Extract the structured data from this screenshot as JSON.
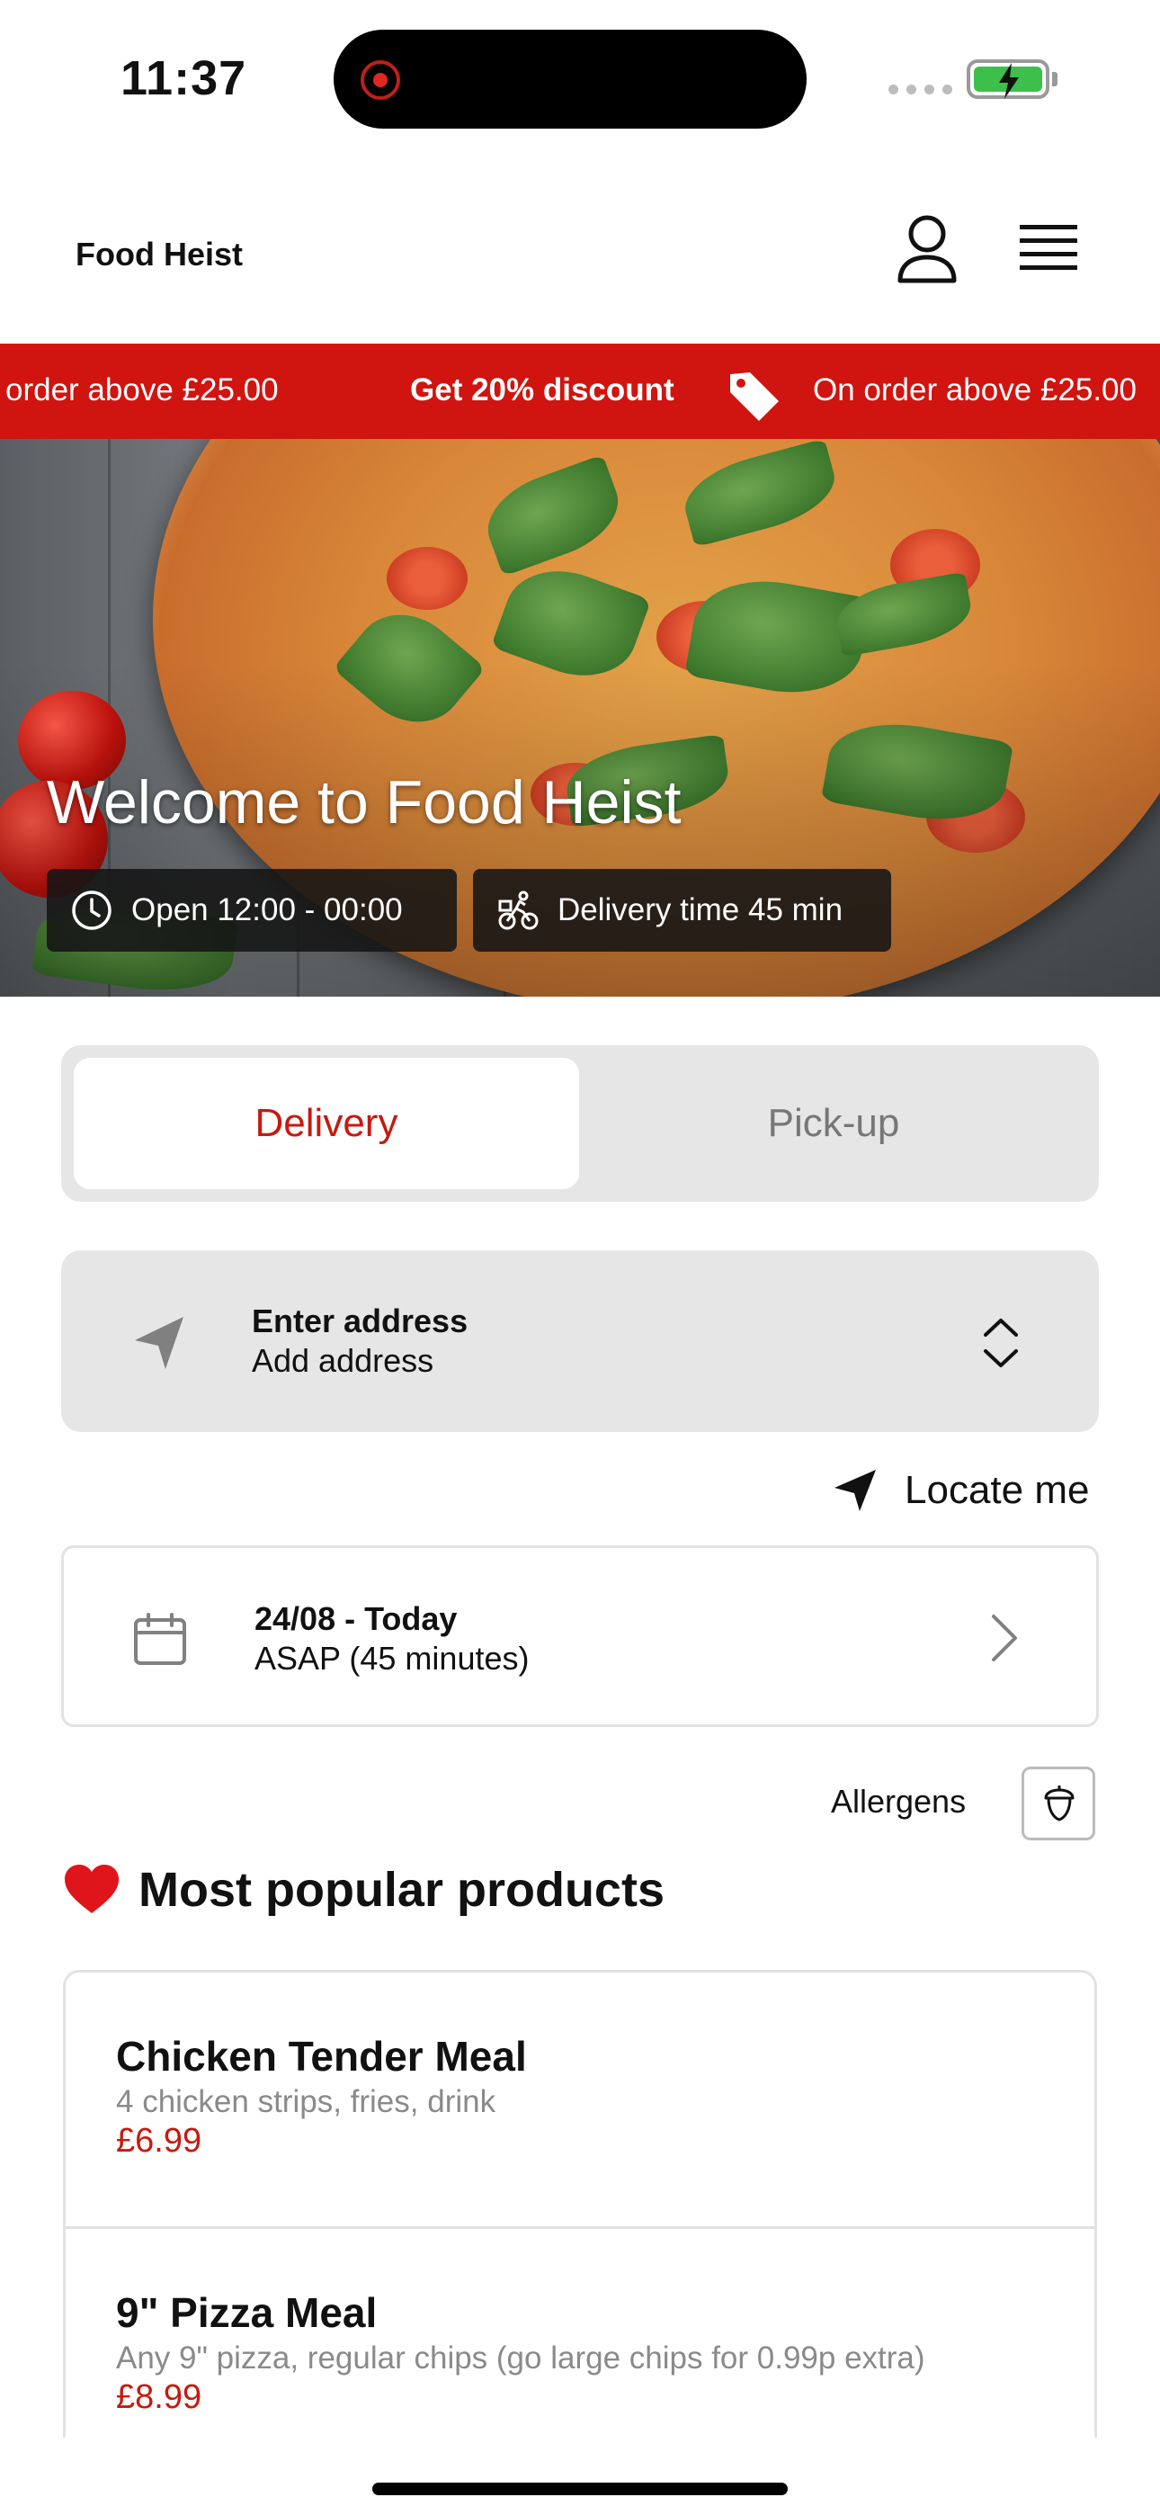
{
  "status_bar": {
    "time": "11:37"
  },
  "header": {
    "brand": "Food Heist"
  },
  "promo": {
    "left_text": "order above £25.00",
    "bold_text": "Get 20% discount",
    "right_text": "On order above £25.00"
  },
  "hero": {
    "title": "Welcome to Food Heist",
    "open_hours": "Open 12:00 - 00:00",
    "delivery_time": "Delivery time 45 min"
  },
  "order_mode": {
    "options": [
      "Delivery",
      "Pick-up"
    ],
    "selected": "Delivery"
  },
  "address": {
    "title": "Enter address",
    "subtitle": "Add address"
  },
  "locate": {
    "label": "Locate me"
  },
  "schedule": {
    "date": "24/08 - Today",
    "time": "ASAP (45 minutes)"
  },
  "allergens": {
    "label": "Allergens"
  },
  "popular": {
    "title": "Most popular products",
    "products": [
      {
        "name": "Chicken Tender Meal",
        "description": "4 chicken strips, fries, drink",
        "price": "£6.99"
      },
      {
        "name": "9\" Pizza Meal",
        "description": "Any 9\" pizza, regular chips (go large chips for 0.99p extra)",
        "price": "£8.99"
      }
    ]
  },
  "colors": {
    "brand_red": "#d0140f",
    "accent_red": "#c7190f",
    "segment_bg": "#e6e6e6"
  }
}
